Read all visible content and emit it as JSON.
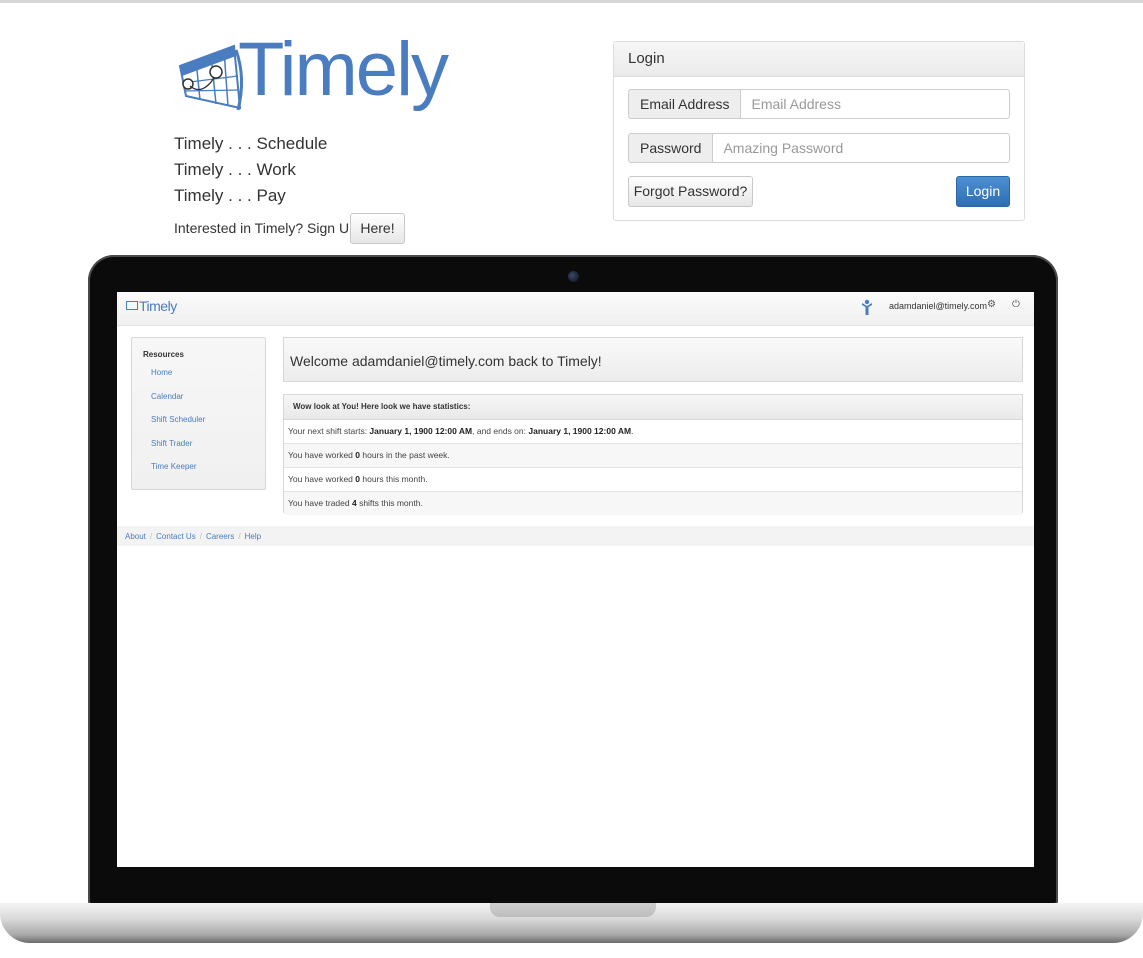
{
  "brand": {
    "name": "Timely",
    "taglines": [
      "Timely . . . Schedule",
      "Timely . . . Work",
      "Timely . . . Pay"
    ],
    "signup_text": "Interested in Timely? Sign Up!",
    "signup_button": "Here!",
    "accent_color": "#4a7cc0"
  },
  "login": {
    "title": "Login",
    "email_label": "Email Address",
    "email_placeholder": "Email Address",
    "password_label": "Password",
    "password_placeholder": "Amazing Password",
    "forgot_button": "Forgot Password?",
    "login_button": "Login",
    "login_button_color": "#3276b1"
  },
  "app": {
    "logo": "Timely",
    "user_email": "adamdaniel@timely.com",
    "icons": [
      "person-icon",
      "gear-icon",
      "power-icon"
    ],
    "sidebar": {
      "title": "Resources",
      "items": [
        "Home",
        "Calendar",
        "Shift Scheduler",
        "Shift Trader",
        "Time Keeper"
      ]
    },
    "welcome": "Welcome adamdaniel@timely.com back to Timely!",
    "stats": {
      "heading": "Wow look at You! Here look we have statistics:",
      "shift": {
        "prefix": "Your next shift starts: ",
        "start": "January 1, 1900 12:00 AM",
        "middle": ", and ends on: ",
        "end": "January 1, 1900 12:00 AM",
        "suffix": "."
      },
      "week": {
        "prefix": "You have worked ",
        "value": "0",
        "suffix": " hours in the past week."
      },
      "month": {
        "prefix": "You have worked ",
        "value": "0",
        "suffix": " hours this month."
      },
      "traded": {
        "prefix": "You have traded ",
        "value": "4",
        "suffix": " shifts this month."
      }
    },
    "footer": [
      "About",
      "Contact Us",
      "Careers",
      "Help"
    ]
  }
}
